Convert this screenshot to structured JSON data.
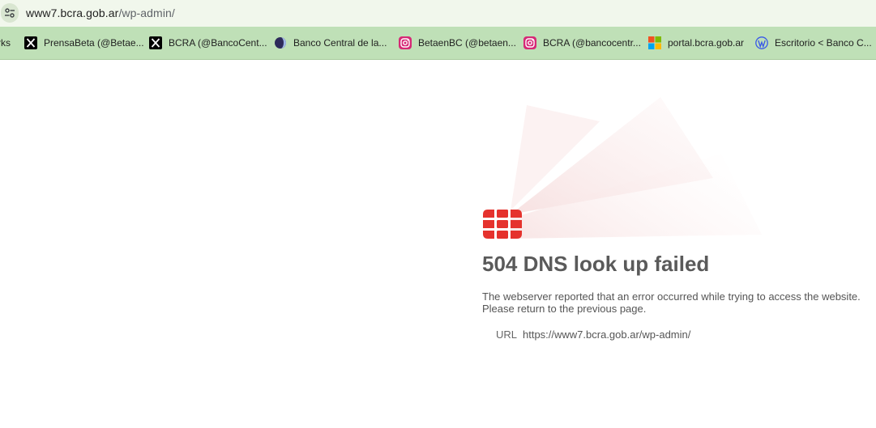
{
  "address_bar": {
    "host": "www7.bcra.gob.ar",
    "path": "/wp-admin/"
  },
  "bookmarks": [
    {
      "label": "rks",
      "icon": "cut-off-bookmark"
    },
    {
      "label": "PrensaBeta (@Betae...",
      "icon": "x-logo-icon"
    },
    {
      "label": "BCRA (@BancoCent...",
      "icon": "x-logo-icon"
    },
    {
      "label": "Banco Central de la...",
      "icon": "bcra-favicon-icon"
    },
    {
      "label": "BetaenBC (@betaen...",
      "icon": "instagram-icon"
    },
    {
      "label": "BCRA (@bancocentr...",
      "icon": "instagram-icon"
    },
    {
      "label": "portal.bcra.gob.ar",
      "icon": "microsoft-logo-icon"
    },
    {
      "label": "Escritorio < Banco C...",
      "icon": "wordpress-icon"
    }
  ],
  "error": {
    "title": "504 DNS look up failed",
    "message_line1": "The webserver reported that an error occurred while trying to access the website.",
    "message_line2": "Please return to the previous page.",
    "url_label": "URL",
    "url_value": "https://www7.bcra.gob.ar/wp-admin/"
  },
  "colors": {
    "bookmarks_bar": "#bfe0b7",
    "address_bar": "#f1f7ec",
    "fortinet_red": "#e5322d",
    "title_text": "#5a5a5a"
  }
}
